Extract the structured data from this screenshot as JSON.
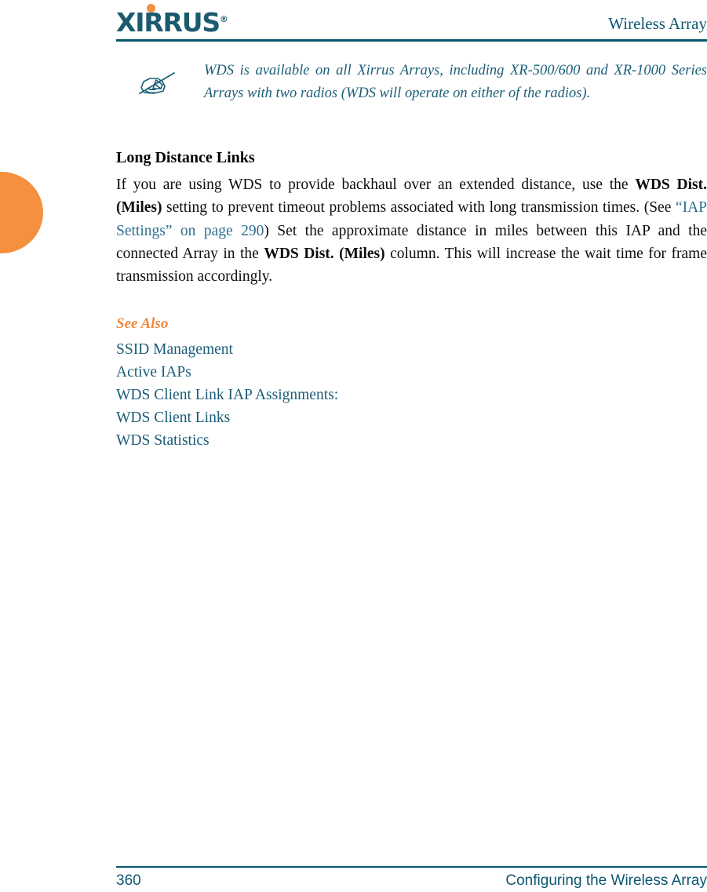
{
  "header": {
    "logo_text": "XIRRUS",
    "logo_registered": "®",
    "title": "Wireless Array"
  },
  "note": {
    "icon": "hand-pencil-note-icon",
    "text": "WDS is available on all Xirrus Arrays, including XR-500/600 and XR-1000 Series Arrays with two radios (WDS will operate on either of the radios)."
  },
  "section": {
    "heading": "Long Distance Links",
    "paragraph": {
      "part1": "If you are using WDS to provide backhaul over an extended distance, use the ",
      "bold1": "WDS Dist. (Miles)",
      "part2": " setting to prevent timeout problems associated with long transmission times. (See ",
      "link": "“IAP Settings” on page 290",
      "part3": ") Set the approximate distance in miles between this IAP and the connected Array in the ",
      "bold2": "WDS Dist. (Miles)",
      "part4": " column. This will increase the wait time for frame transmission accordingly."
    }
  },
  "see_also": {
    "title": "See Also",
    "items": [
      "SSID Management",
      "Active IAPs",
      "WDS Client Link IAP Assignments:",
      "WDS Client Links",
      "WDS Statistics"
    ]
  },
  "footer": {
    "page_number": "360",
    "section_title": "Configuring the Wireless Array"
  },
  "colors": {
    "brand_teal": "#0A556E",
    "brand_orange": "#F4903E",
    "link_teal": "#2E6E8E",
    "see_also_orange": "#F0883C",
    "note_teal": "#1A5E77"
  }
}
